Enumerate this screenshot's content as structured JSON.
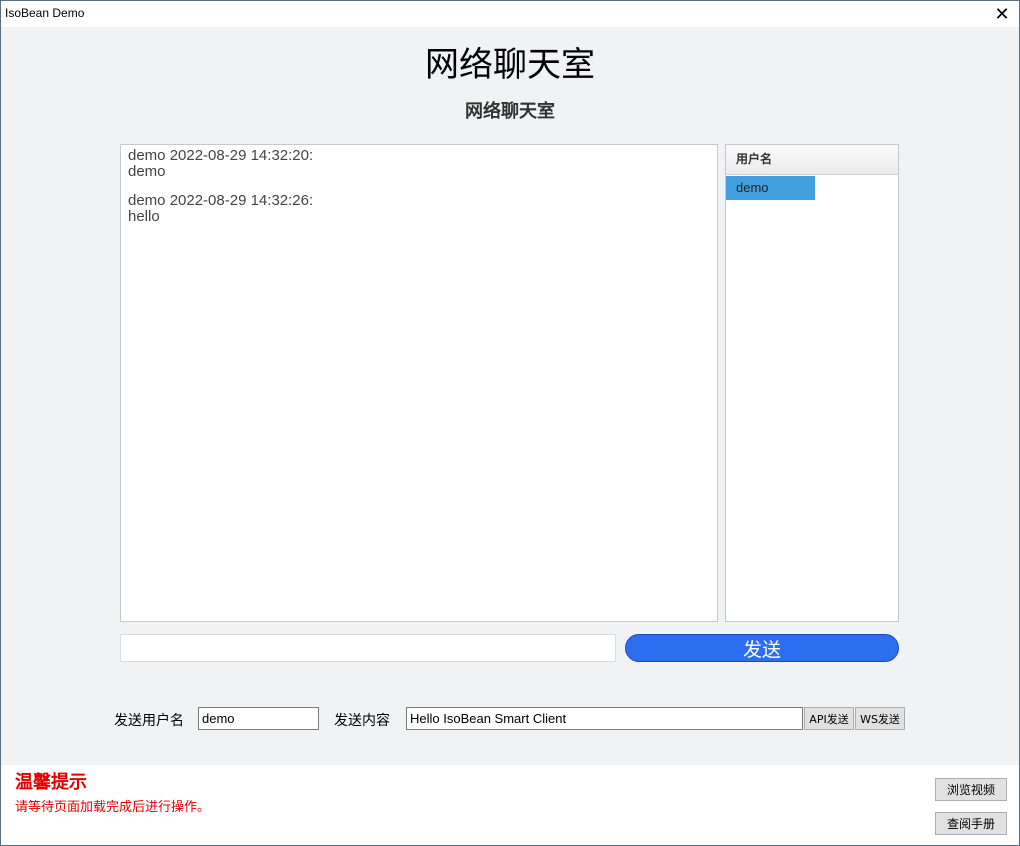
{
  "window": {
    "title": "IsoBean Demo",
    "close_glyph": "✕"
  },
  "header": {
    "main_title": "网络聊天室",
    "sub_title": "网络聊天室"
  },
  "chat": {
    "messages": [
      {
        "meta": "demo 2022-08-29 14:32:20:",
        "text": "demo"
      },
      {
        "meta": "demo 2022-08-29 14:32:26:",
        "text": "hello"
      }
    ]
  },
  "users": {
    "header": "用户名",
    "items": [
      "demo"
    ]
  },
  "composer": {
    "input_value": "",
    "send_label": "发送"
  },
  "api_form": {
    "username_label": "发送用户名",
    "username_value": "demo",
    "content_label": "发送内容",
    "content_value": "Hello IsoBean Smart Client",
    "api_send_label": "API发送",
    "ws_send_label": "WS发送"
  },
  "tip": {
    "title": "温馨提示",
    "text": "请等待页面加载完成后进行操作。"
  },
  "side_buttons": {
    "video_label": "浏览视频",
    "manual_label": "查阅手册"
  },
  "colors": {
    "send_button": "#2d6ef0",
    "selected_user": "#42a0e1",
    "tip": "#e00000"
  }
}
